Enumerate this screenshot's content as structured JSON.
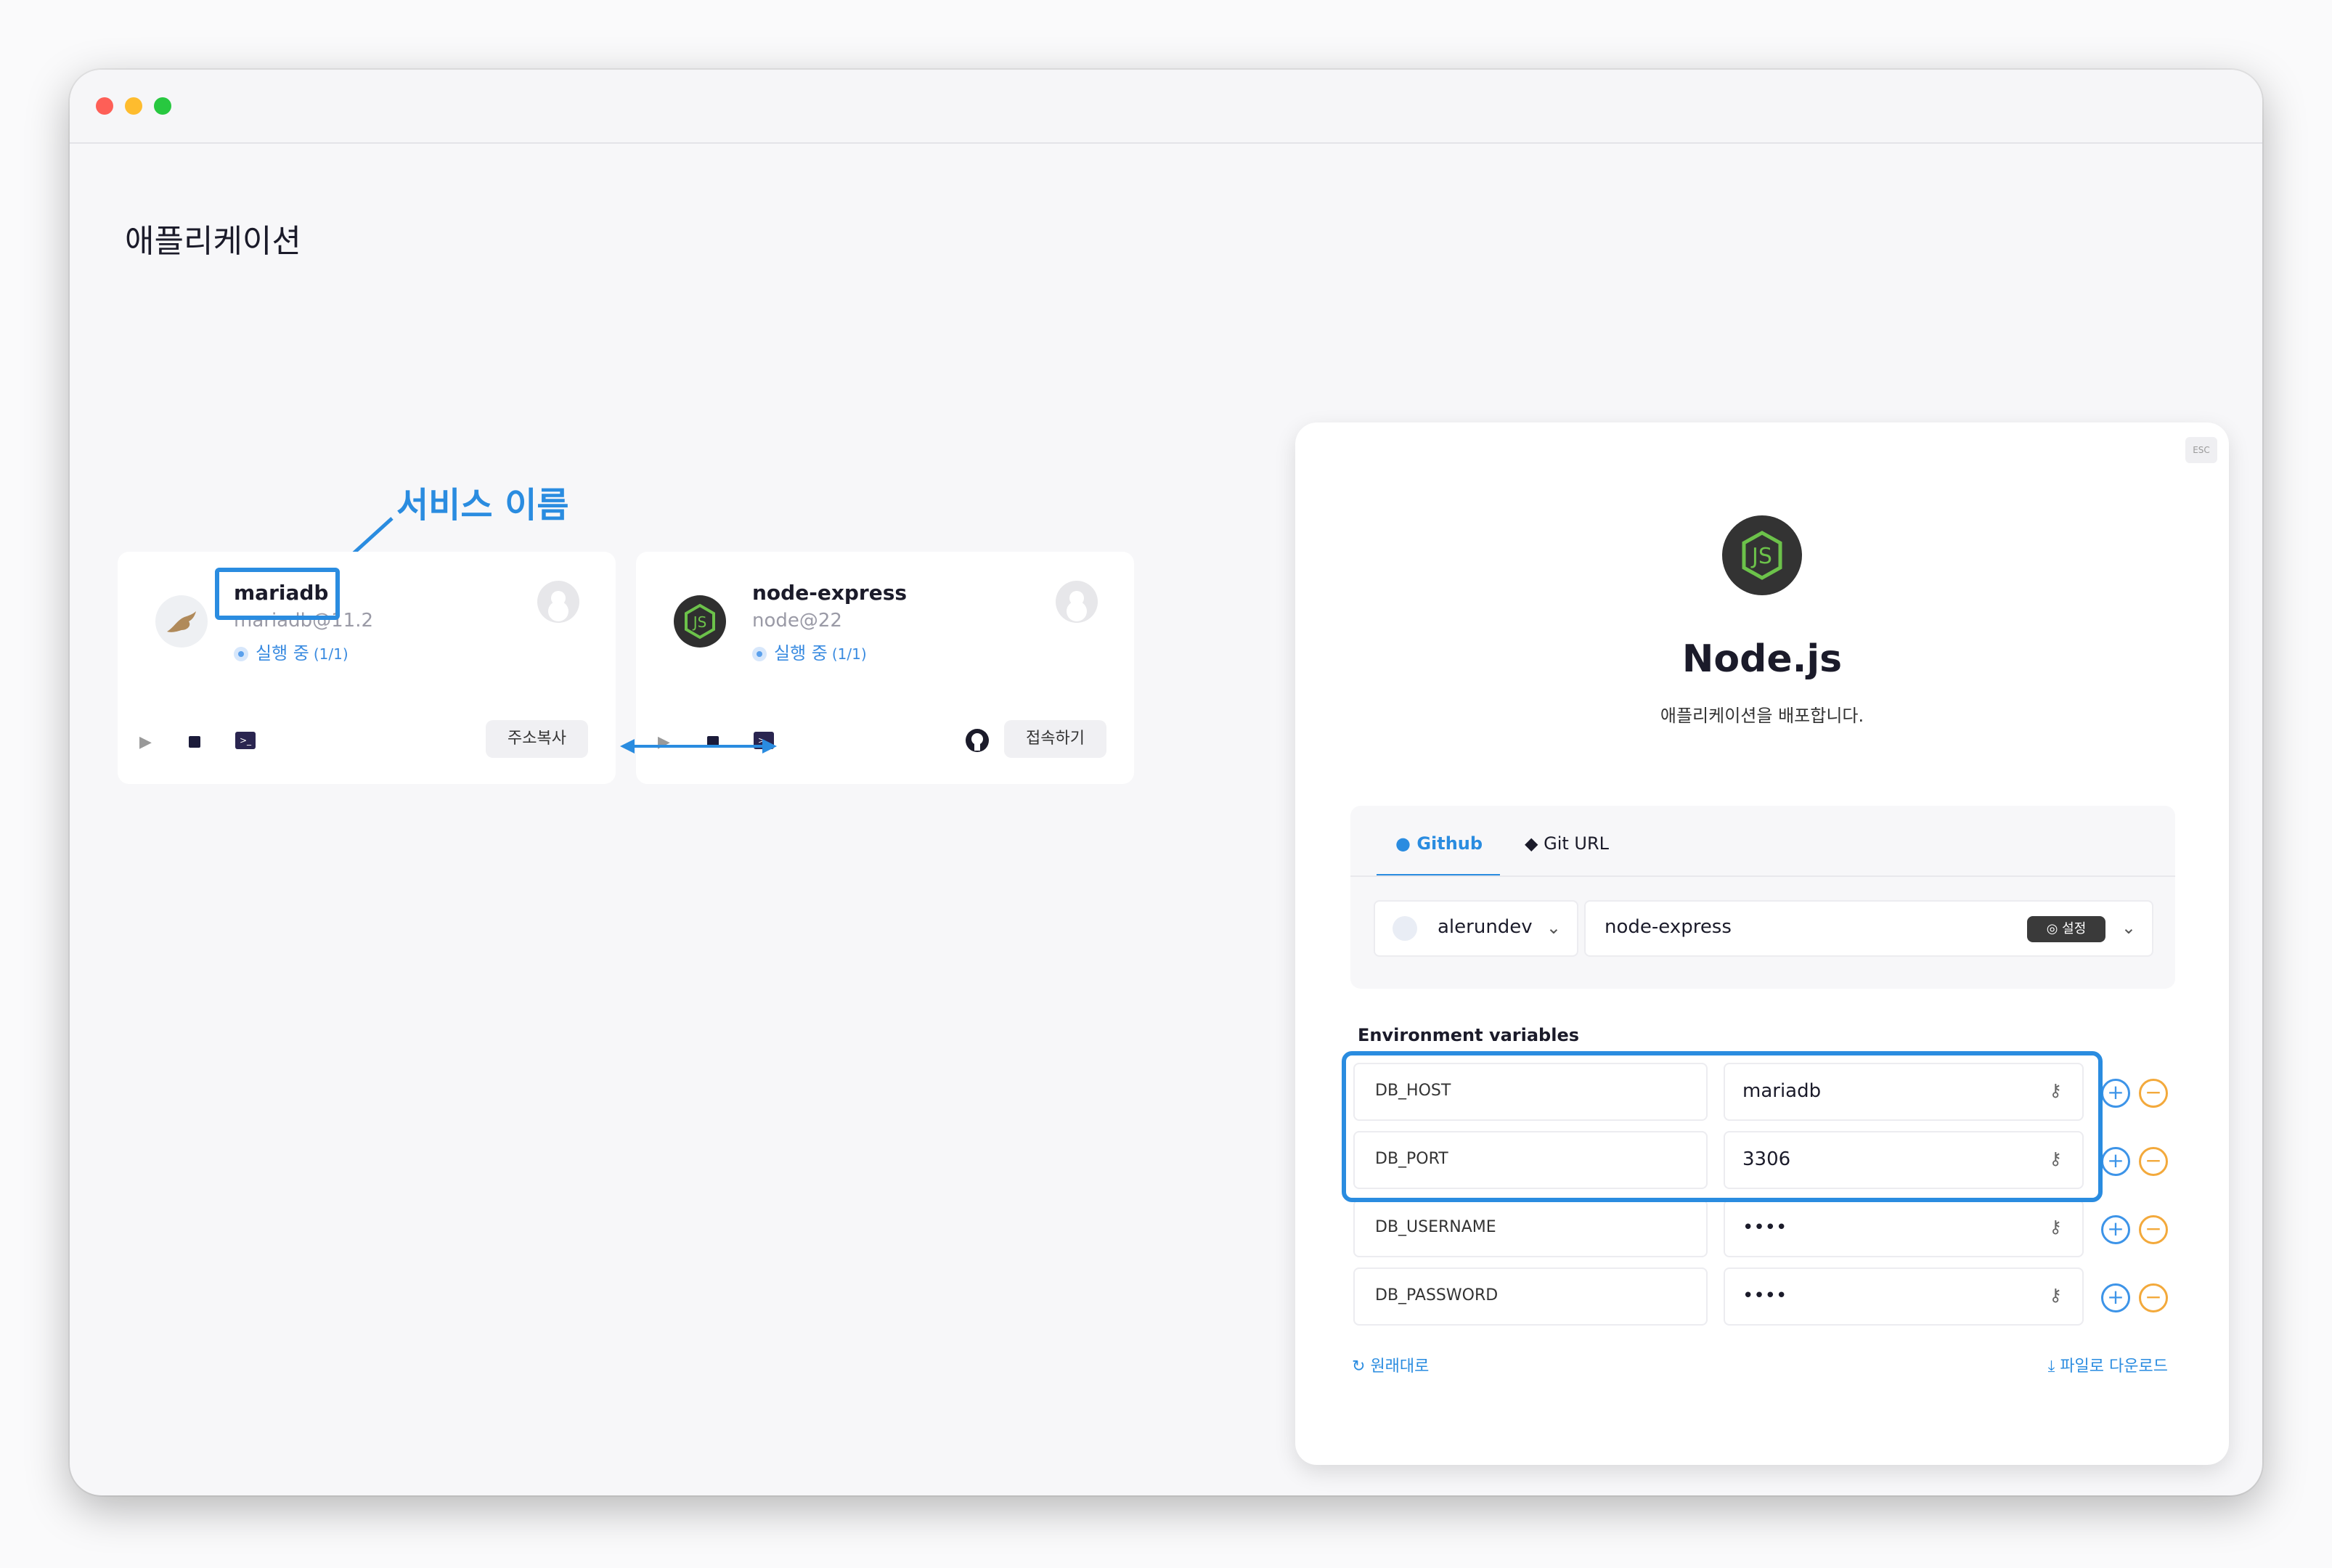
{
  "page": {
    "title": "애플리케이션"
  },
  "annotation": {
    "label": "서비스 이름"
  },
  "services": [
    {
      "name": "mariadb",
      "version": "mariadb@11.2",
      "status": "실행 중",
      "count": "(1/1)",
      "button": "주소복사",
      "terminal_glyph": ">_"
    },
    {
      "name": "node-express",
      "version": "node@22",
      "status": "실행 중",
      "count": "(1/1)",
      "button": "접속하기",
      "terminal_glyph": ">_"
    }
  ],
  "modal": {
    "esc": "ESC",
    "title": "Node.js",
    "subtitle": "애플리케이션을 배포합니다.",
    "tabs": [
      {
        "label": "Github",
        "active": true
      },
      {
        "label": "Git URL",
        "active": false
      }
    ],
    "owner": "alerundev",
    "repo": "node-express",
    "settings_label": "설정",
    "env_title": "Environment variables",
    "env": [
      {
        "key": "DB_HOST",
        "value": "mariadb"
      },
      {
        "key": "DB_PORT",
        "value": "3306"
      },
      {
        "key": "DB_USERNAME",
        "value": "••••"
      },
      {
        "key": "DB_PASSWORD",
        "value": "••••"
      }
    ],
    "reset_label": "원래대로",
    "download_label": "파일로 다운로드"
  },
  "colors": {
    "accent": "#2a8ce0",
    "plus": "#3d94e8",
    "minus": "#f3a93b",
    "node_green": "#6cc24a"
  },
  "icons": [
    "play-icon",
    "stop-icon",
    "terminal-icon",
    "github-icon",
    "git-icon",
    "key-icon",
    "plus-icon",
    "minus-icon",
    "refresh-icon",
    "download-icon",
    "chevron-down-icon"
  ]
}
